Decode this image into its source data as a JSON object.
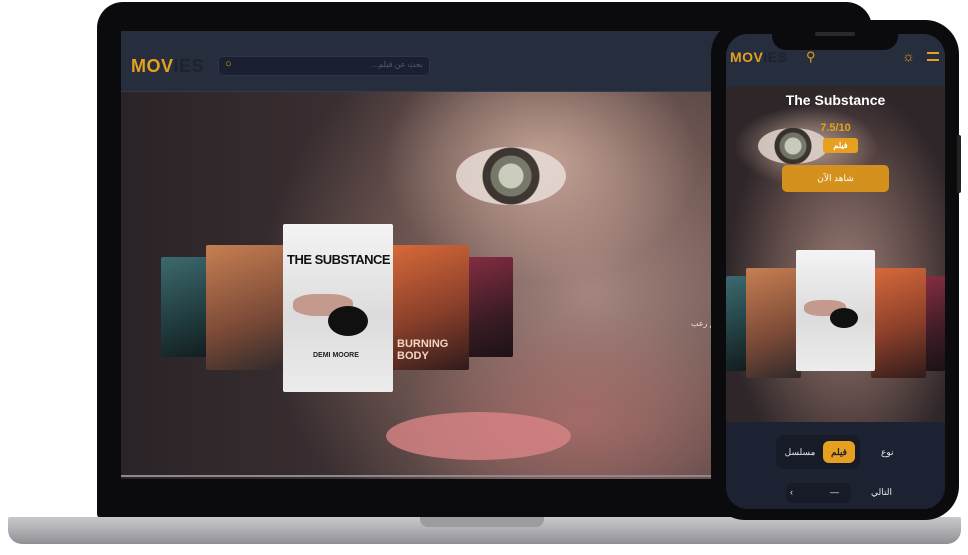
{
  "desktop": {
    "logo_primary": "MOV",
    "logo_secondary": "IES",
    "search_placeholder": "...بحث عن فيلم",
    "side_caption": "فيلم رعب"
  },
  "posters": {
    "center_title": "THE SUBSTANCE",
    "center_caption": "DEMI MOORE",
    "right_title": "BURNING BODY"
  },
  "mobile": {
    "logo_primary": "MOV",
    "logo_secondary": "IES",
    "movie_title": "The Substance",
    "rating": "7.5/10",
    "badge": "فيلم",
    "cta": "شاهد الآن",
    "tabs": [
      "مسلسل",
      "فيلم"
    ],
    "tab_type": "نوع",
    "pager_prev": "‹",
    "pager_current": "—",
    "pager_next": "التالي"
  },
  "colors": {
    "accent": "#e6a020",
    "header": "#262d3c",
    "background": "#1f2433"
  },
  "icons": {
    "search": "search-icon",
    "theme": "sun-icon",
    "menu": "menu-icon"
  }
}
